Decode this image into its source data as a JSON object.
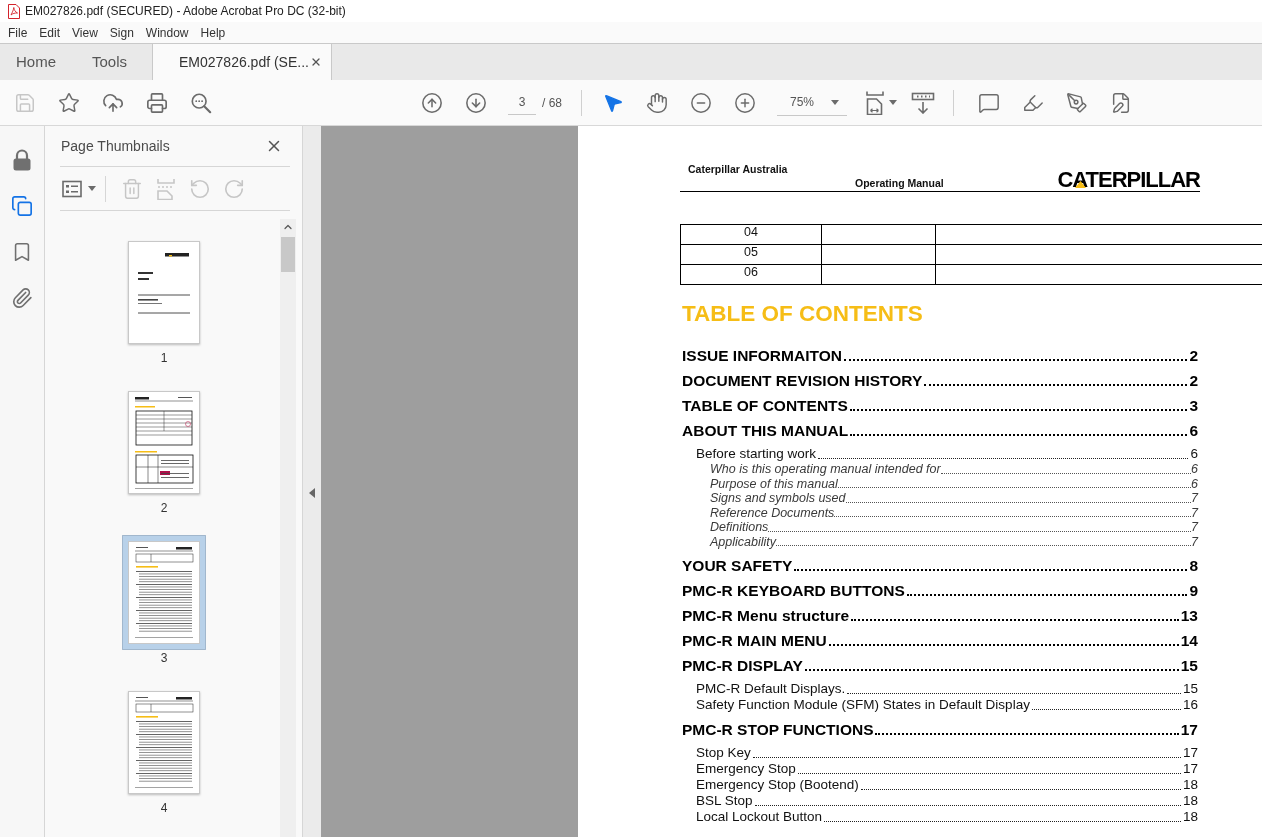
{
  "window": {
    "title": "EM027826.pdf (SECURED) - Adobe Acrobat Pro DC (32-bit)"
  },
  "menu": [
    "File",
    "Edit",
    "View",
    "Sign",
    "Window",
    "Help"
  ],
  "tabs": [
    {
      "label": "Home",
      "selected": false,
      "closable": false
    },
    {
      "label": "Tools",
      "selected": false,
      "closable": false
    },
    {
      "label": "EM027826.pdf (SE...",
      "selected": true,
      "closable": true
    }
  ],
  "toolbar": {
    "file_tools": [
      {
        "kind": "save",
        "disabled": true
      },
      {
        "kind": "star",
        "disabled": false
      },
      {
        "kind": "upload",
        "disabled": false
      },
      {
        "kind": "print",
        "disabled": false
      },
      {
        "kind": "find",
        "disabled": false
      }
    ],
    "nav_tools": [
      {
        "kind": "previous"
      },
      {
        "kind": "next"
      }
    ],
    "page_field": {
      "value": "3"
    },
    "page_count": "/ 68",
    "pointer_tools": [
      {
        "kind": "select",
        "selected": true
      },
      {
        "kind": "hand",
        "selected": false
      }
    ],
    "zoom_tools": [
      {
        "kind": "zoom-out"
      },
      {
        "kind": "zoom-in"
      }
    ],
    "zoom_field": {
      "value": "75%"
    },
    "view_tools": [
      {
        "kind": "page-fit"
      },
      {
        "kind": "scroll-mode"
      }
    ],
    "annotate_tools": [
      {
        "kind": "comment"
      },
      {
        "kind": "highlight"
      },
      {
        "kind": "sign"
      },
      {
        "kind": "edit"
      }
    ]
  },
  "side_rail": [
    {
      "kind": "security",
      "selected": false
    },
    {
      "kind": "pages",
      "selected": true
    },
    {
      "kind": "bookmarks",
      "selected": false
    },
    {
      "kind": "attachments",
      "selected": false
    }
  ],
  "thumbnails": {
    "title": "Page Thumbnails",
    "tools": [
      {
        "kind": "options",
        "disabled": false
      },
      {
        "kind": "delete",
        "disabled": true
      },
      {
        "kind": "extract",
        "disabled": true
      },
      {
        "kind": "rotate-left",
        "disabled": true
      },
      {
        "kind": "rotate-right",
        "disabled": true
      }
    ],
    "items": [
      {
        "kind": "cover",
        "label": "1",
        "selected": false
      },
      {
        "kind": "form",
        "label": "2",
        "selected": false
      },
      {
        "kind": "contents",
        "label": "3",
        "selected": true
      },
      {
        "kind": "contents",
        "label": "4",
        "selected": false
      }
    ]
  },
  "document": {
    "header": {
      "company": "Caterpillar Australia",
      "title": "Operating Manual",
      "logo": "CATERPILLAR"
    },
    "revision_table": {
      "rows": [
        {
          "column_1": "04"
        },
        {
          "column_1": "05"
        },
        {
          "column_1": "06"
        }
      ]
    },
    "heading": "TABLE OF CONTENTS",
    "toc": [
      {
        "title": "ISSUE INFORMAITON",
        "page": "2"
      },
      {
        "title": "DOCUMENT REVISION HISTORY",
        "page": "2"
      },
      {
        "title": "TABLE OF CONTENTS",
        "page": "3"
      },
      {
        "title": "ABOUT THIS MANUAL",
        "page": "6",
        "children": [
          {
            "title": "Before starting work",
            "page": "6",
            "children": [
              {
                "title": "Who is this operating manual intended for",
                "page": "6"
              },
              {
                "title": "Purpose of this manual",
                "page": "6"
              },
              {
                "title": "Signs and symbols used",
                "page": "7"
              },
              {
                "title": "Reference Documents",
                "page": "7"
              },
              {
                "title": "Definitions",
                "page": "7"
              },
              {
                "title": "Applicability",
                "page": "7"
              }
            ]
          }
        ]
      },
      {
        "title": "YOUR SAFETY",
        "page": "8"
      },
      {
        "title": "PMC-R KEYBOARD BUTTONS",
        "page": "9"
      },
      {
        "title": "PMC-R Menu structure",
        "page": "13"
      },
      {
        "title": "PMC-R MAIN MENU",
        "page": "14"
      },
      {
        "title": "PMC-R DISPLAY",
        "page": "15",
        "children": [
          {
            "title": "PMC-R Default Displays.",
            "page": "15"
          },
          {
            "title": "Safety Function Module (SFM) States in Default Display",
            "page": "16"
          }
        ]
      },
      {
        "title": "PMC-R STOP FUNCTIONS",
        "page": "17",
        "children": [
          {
            "title": "Stop Key",
            "page": "17"
          },
          {
            "title": "Emergency Stop",
            "page": "17"
          },
          {
            "title": "Emergency Stop (Bootend)",
            "page": "18"
          },
          {
            "title": "BSL Stop",
            "page": "18"
          },
          {
            "title": "Local Lockout Button",
            "page": "18"
          }
        ]
      }
    ]
  }
}
